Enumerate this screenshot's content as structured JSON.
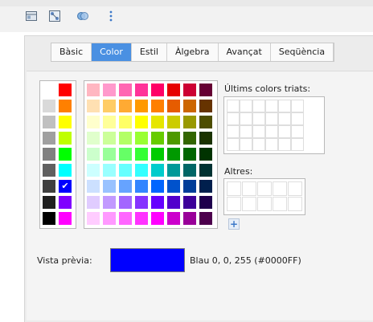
{
  "tabs": [
    {
      "label": "Bàsic"
    },
    {
      "label": "Color",
      "active": true
    },
    {
      "label": "Estil"
    },
    {
      "label": "Àlgebra"
    },
    {
      "label": "Avançat"
    },
    {
      "label": "Seqüència"
    }
  ],
  "recent_label": "Últims colors triats:",
  "others_label": "Altres:",
  "preview_label": "Vista prèvia:",
  "preview_value": "Blau 0, 0, 255 (#0000FF)",
  "colors": {
    "preview": "#0000ff",
    "tab_active": "#4a90e2",
    "left_column_1": [
      "#ffffff",
      "#d9d9d9",
      "#c0c0c0",
      "#a0a0a0",
      "#808080",
      "#606060",
      "#404040",
      "#202020",
      "#000000"
    ],
    "left_column_2": [
      "#ff0000",
      "#ff8000",
      "#ffff00",
      "#bfff00",
      "#00ff00",
      "#00ffff",
      "#0000ff",
      "#8000ff",
      "#ff00ff"
    ],
    "palette": [
      [
        "#ffb6c1",
        "#ff99cc",
        "#ff66b2",
        "#ff3399",
        "#ff0066",
        "#e60000",
        "#cc0033",
        "#660033"
      ],
      [
        "#ffe0b2",
        "#ffcc66",
        "#ffaa33",
        "#ff9900",
        "#ff7f00",
        "#e65c00",
        "#cc6600",
        "#663300"
      ],
      [
        "#ffffcc",
        "#ffff99",
        "#ffff66",
        "#ffff00",
        "#e6e600",
        "#cccc00",
        "#999900",
        "#4d4d00"
      ],
      [
        "#e0ffcc",
        "#ccff99",
        "#b3ff66",
        "#99ff33",
        "#66cc00",
        "#4d9900",
        "#336600",
        "#1a3300"
      ],
      [
        "#ccffcc",
        "#99ff99",
        "#66ff66",
        "#33ff33",
        "#00cc00",
        "#009900",
        "#006600",
        "#003300"
      ],
      [
        "#ccffff",
        "#99ffff",
        "#66ffff",
        "#33ffff",
        "#00cccc",
        "#009999",
        "#006666",
        "#003333"
      ],
      [
        "#cce0ff",
        "#99c2ff",
        "#66a3ff",
        "#3385ff",
        "#0066ff",
        "#0052cc",
        "#003d99",
        "#001f4d"
      ],
      [
        "#e0ccff",
        "#c299ff",
        "#a366ff",
        "#8533ff",
        "#6600ff",
        "#5200cc",
        "#3d0099",
        "#1f004d"
      ],
      [
        "#ffccff",
        "#ff99ff",
        "#ff66ff",
        "#ff33ff",
        "#ff00ff",
        "#cc00cc",
        "#990099",
        "#4d004d"
      ]
    ]
  },
  "toolbar_icons": [
    "style-icon",
    "object-icon",
    "properties-icon",
    "more-icon"
  ]
}
